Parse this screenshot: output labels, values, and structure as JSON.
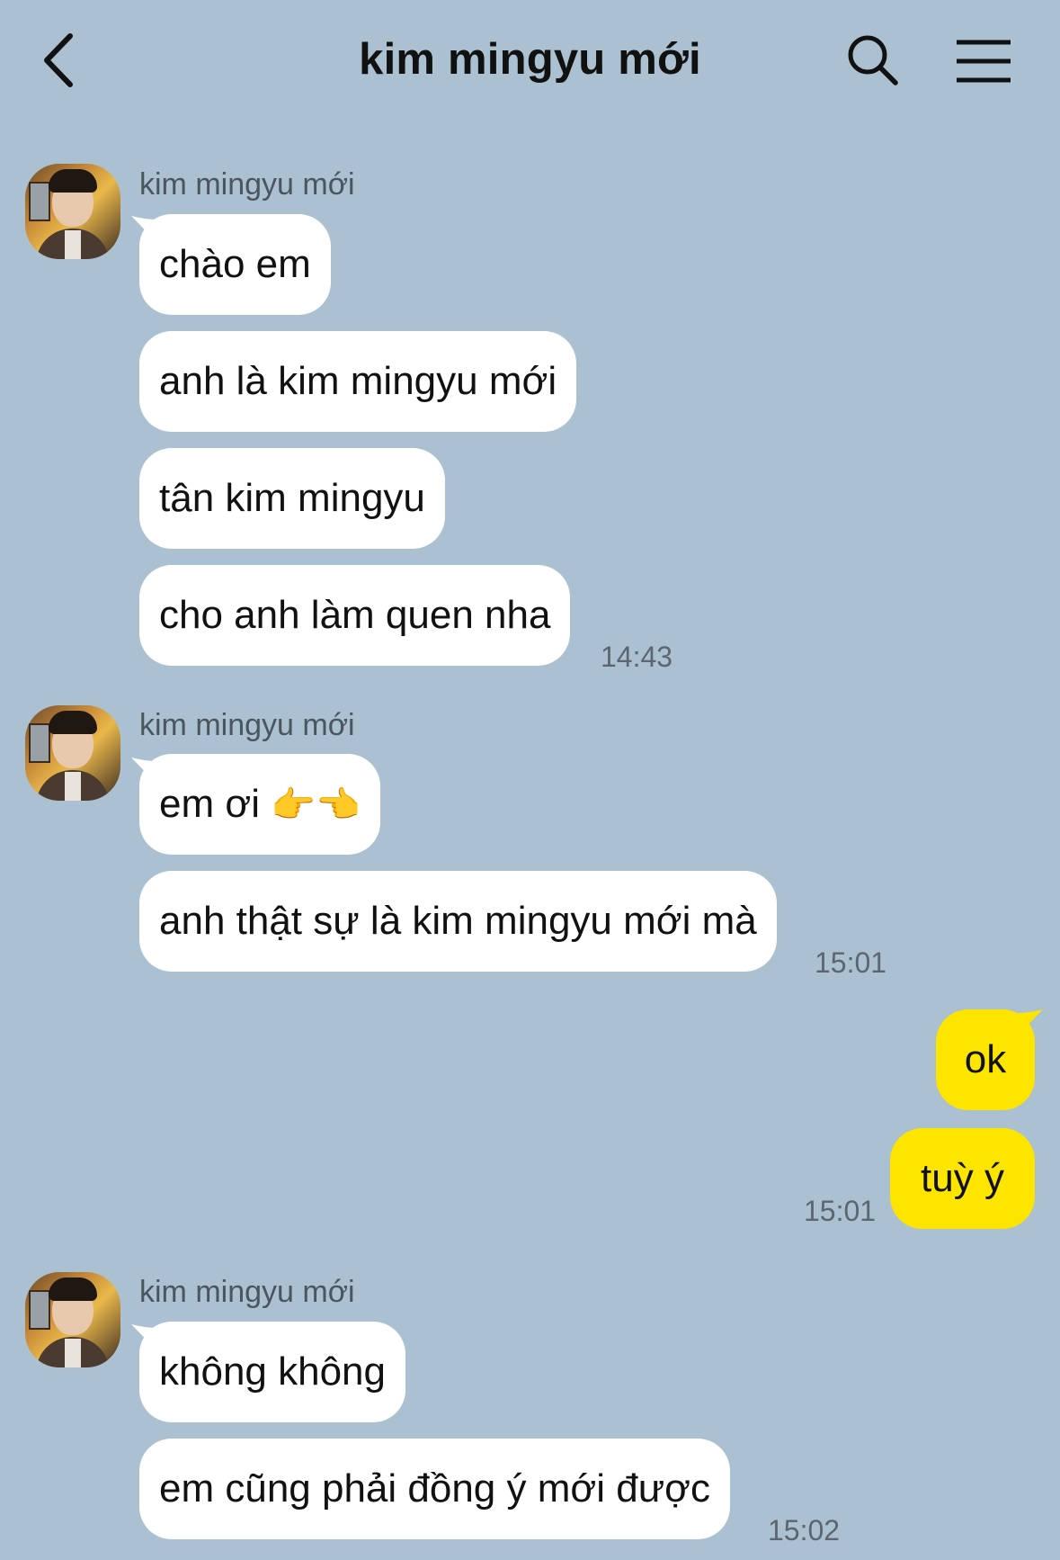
{
  "header": {
    "title": "kim mingyu mới"
  },
  "icons": {
    "back": "chevron-left-icon",
    "search": "search-icon",
    "menu": "hamburger-menu-icon"
  },
  "colors": {
    "background": "#abc1d1",
    "incoming_bubble": "#ffffff",
    "outgoing_bubble": "#fee500"
  },
  "messages": {
    "g1": {
      "sender": "kim mingyu mới",
      "m1": "chào em",
      "m2": "anh là kim mingyu mới",
      "m3": "tân kim mingyu",
      "m4": "cho anh làm quen nha",
      "time": "14:43"
    },
    "g2": {
      "sender": "kim mingyu mới",
      "m1": "em ơi",
      "m1_emoji": "👉👈",
      "m2": "anh thật sự là kim mingyu mới mà",
      "time": "15:01"
    },
    "g3": {
      "m1": "ok",
      "m2": "tuỳ ý",
      "time": "15:01"
    },
    "g4": {
      "sender": "kim mingyu mới",
      "m1": "không không",
      "m2": "em cũng phải đồng ý mới được",
      "time": "15:02"
    }
  }
}
